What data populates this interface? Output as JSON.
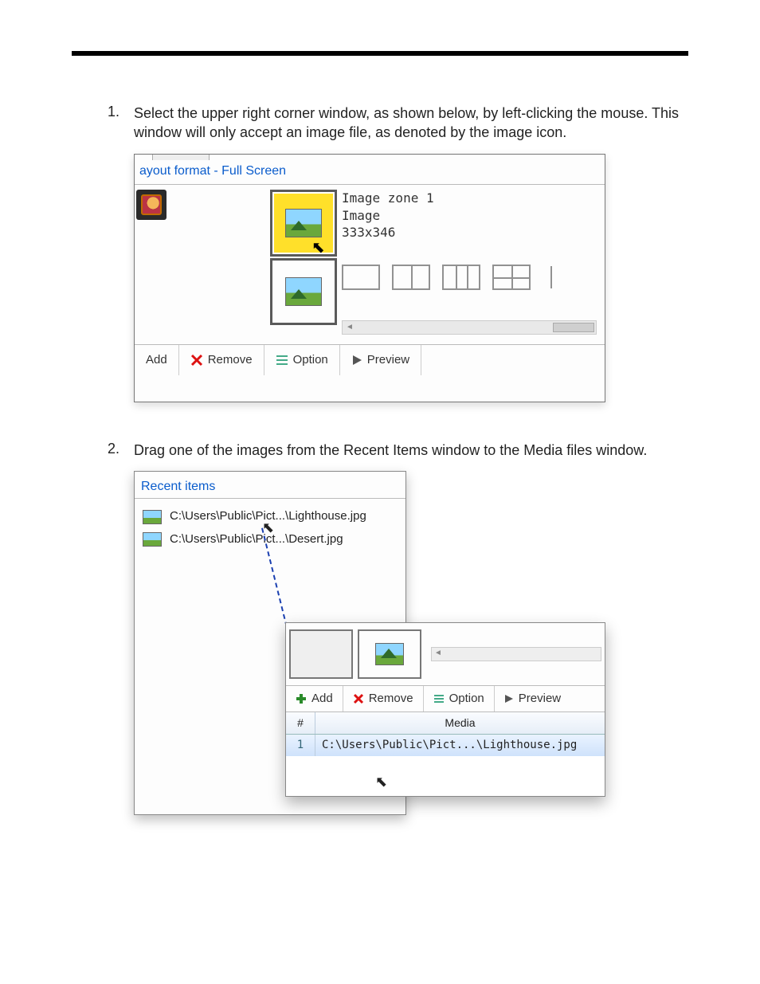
{
  "steps": [
    {
      "num": "1.",
      "text": "Select the upper right corner window, as shown below, by left-clicking the mouse.  This window will only accept an image file, as denoted by the image icon."
    },
    {
      "num": "2.",
      "text": "Drag one of the images from the Recent Items window to the Media files window."
    }
  ],
  "ss1": {
    "title": "ayout format - Full Screen",
    "info_line1": "Image zone 1",
    "info_line2": "Image",
    "info_line3": "333x346",
    "toolbar": {
      "add": "Add",
      "remove": "Remove",
      "option": "Option",
      "preview": "Preview"
    }
  },
  "ss2": {
    "recent_title": "Recent items",
    "recent_items": [
      "C:\\Users\\Public\\Pict...\\Lighthouse.jpg",
      "C:\\Users\\Public\\Pict...\\Desert.jpg"
    ],
    "toolbar": {
      "add": "Add",
      "remove": "Remove",
      "option": "Option",
      "preview": "Preview"
    },
    "table": {
      "col_num": "#",
      "col_media": "Media",
      "row_num": "1",
      "row_path": "C:\\Users\\Public\\Pict...\\Lighthouse.jpg"
    }
  }
}
